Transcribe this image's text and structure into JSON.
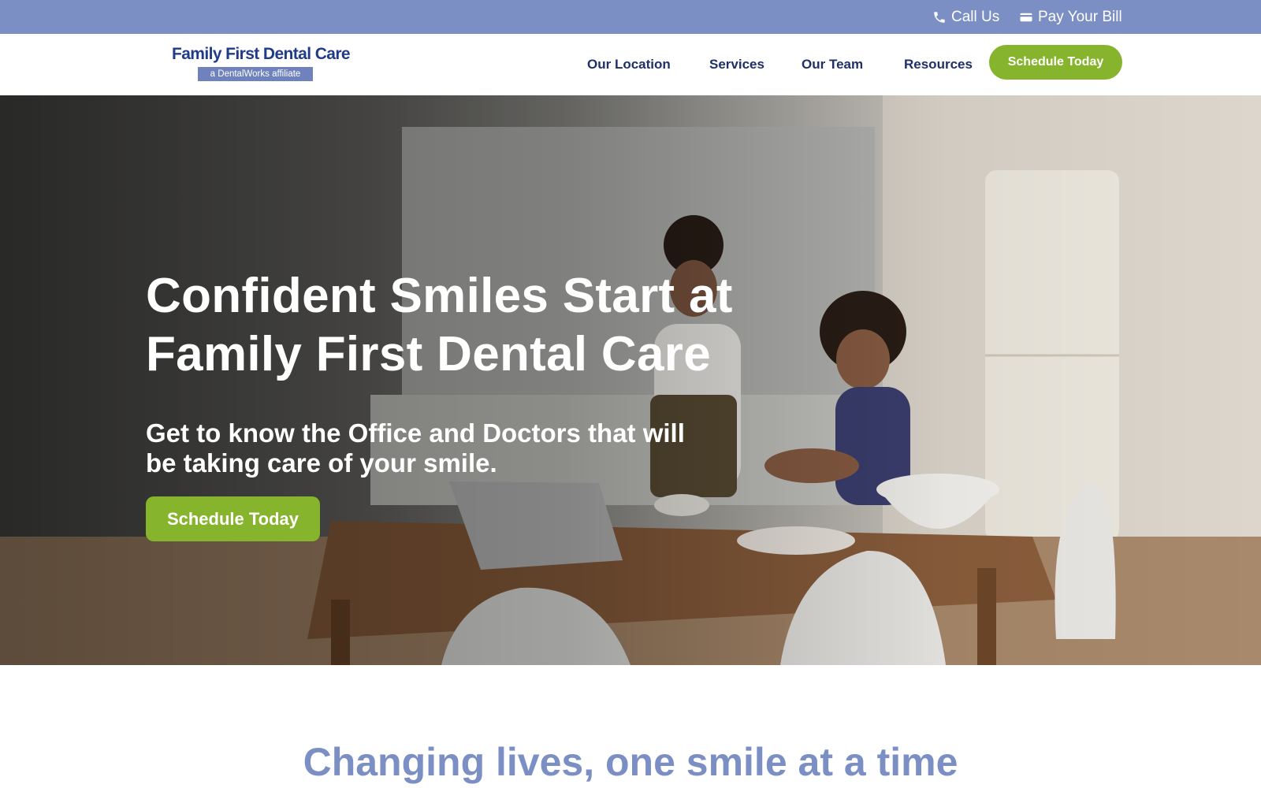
{
  "utility_bar": {
    "call_label": "Call Us",
    "call_icon": "phone-icon",
    "bill_label": "Pay Your Bill",
    "bill_icon": "credit-card-icon",
    "background": "#7b8fc4"
  },
  "header": {
    "logo_title": "Family First Dental Care",
    "logo_tagline": "a DentalWorks affiliate",
    "nav": [
      {
        "label": "Our Location"
      },
      {
        "label": "Services"
      },
      {
        "label": "Our Team"
      },
      {
        "label": "Resources"
      }
    ],
    "cta_label": "Schedule Today",
    "accent": "#86b52d"
  },
  "hero": {
    "title": "Confident Smiles Start at Family First Dental Care",
    "subtitle": "Get to know the Office and Doctors that will be taking care of your smile.",
    "cta_label": "Schedule Today"
  },
  "intro": {
    "heading": "Changing lives, one smile at a time",
    "heading_color": "#7b8fc4"
  }
}
